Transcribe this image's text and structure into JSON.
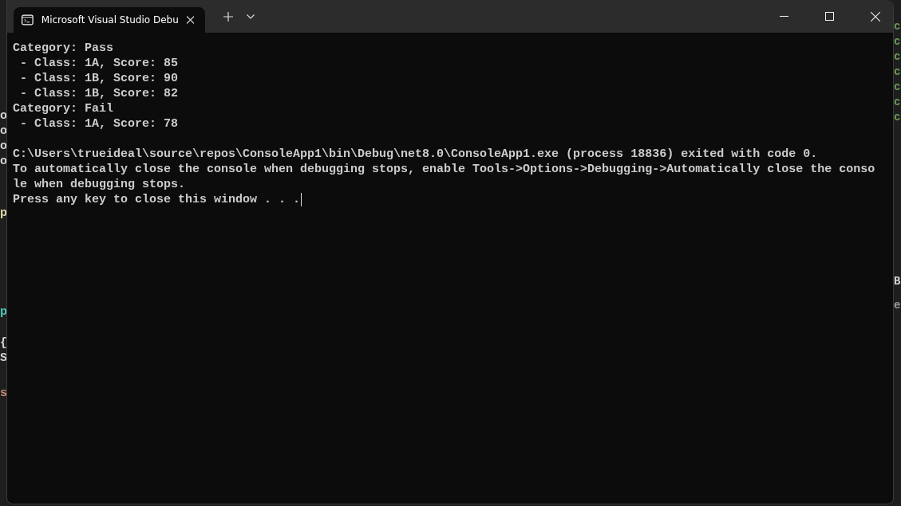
{
  "window": {
    "tab": {
      "title": "Microsoft Visual Studio Debu",
      "selected": true
    }
  },
  "console": {
    "blocks": [
      [
        "Category: Pass",
        " - Class: 1A, Score: 85",
        " - Class: 1B, Score: 90",
        " - Class: 1B, Score: 82",
        "Category: Fail",
        " - Class: 1A, Score: 78"
      ],
      [
        "C:\\Users\\trueideal\\source\\repos\\ConsoleApp1\\bin\\Debug\\net8.0\\ConsoleApp1.exe (process 18836) exited with code 0.",
        "To automatically close the console when debugging stops, enable Tools->Options->Debugging->Automatically close the conso",
        "le when debugging stops.",
        "Press any key to close this window . . ."
      ]
    ]
  },
  "background_left": [
    {
      "text": "o",
      "color": "#d4d4d4"
    },
    {
      "text": "o",
      "color": "#d4d4d4"
    },
    {
      "text": "o",
      "color": "#d4d4d4"
    },
    {
      "text": "o",
      "color": "#d4d4d4"
    },
    {
      "text": "p",
      "color": "#dcdcaa"
    },
    {
      "text": "p",
      "color": "#4ec9b0"
    },
    {
      "text": "{",
      "color": "#d4d4d4"
    },
    {
      "text": "S",
      "color": "#d4d4d4"
    },
    {
      "text": "s",
      "color": "#ce9178"
    }
  ],
  "background_right": [
    {
      "text": "c",
      "color": "#6a9955"
    },
    {
      "text": "c",
      "color": "#6a9955"
    },
    {
      "text": "c",
      "color": "#6a9955"
    },
    {
      "text": "c",
      "color": "#6a9955"
    },
    {
      "text": "c",
      "color": "#6a9955"
    },
    {
      "text": "c",
      "color": "#6a9955"
    },
    {
      "text": "c",
      "color": "#6a9955"
    },
    {
      "text": "B",
      "color": "#d4d4d4"
    },
    {
      "text": "e",
      "color": "#9d9d9d"
    }
  ]
}
